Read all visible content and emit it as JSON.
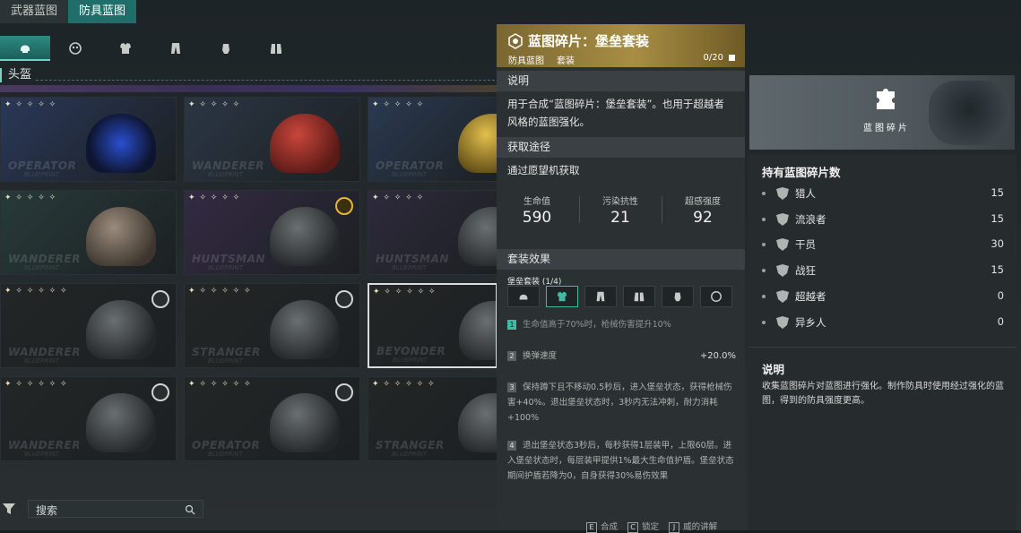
{
  "top_tabs": [
    {
      "label": "武器蓝图"
    },
    {
      "label": "防具蓝图"
    }
  ],
  "section_label": "头盔",
  "icons": [
    "helmet-icon",
    "mask-icon",
    "armor-icon",
    "pants-icon",
    "glove-icon",
    "boots-icon"
  ],
  "cards": [
    {
      "brand": "OPERATOR",
      "sub": "BLUEPRINT",
      "stars": "✦ ✧ ✧ ✧ ✧",
      "badge": "",
      "item": "goggles-item",
      "bg": "#2a3858"
    },
    {
      "brand": "WANDERER",
      "sub": "BLUEPRINT",
      "stars": "✦ ✧ ✧ ✧ ✧",
      "badge": "",
      "item": "red-helmet-item",
      "bg": "#2b3644"
    },
    {
      "brand": "OPERATOR",
      "sub": "BLUEPRINT",
      "stars": "✦ ✧ ✧ ✧ ✧",
      "badge": "",
      "item": "gold-helmet-item",
      "bg": "#2a3a52"
    },
    {
      "brand": "WANDERER",
      "sub": "BLUEPRINT",
      "stars": "✦ ✧ ✧ ✧ ✧",
      "badge": "",
      "item": "cap-item",
      "bg": "#283a3a"
    },
    {
      "brand": "HUNTSMAN",
      "sub": "BLUEPRINT",
      "stars": "✦ ✧ ✧ ✧ ✧",
      "badge": "gold",
      "item": "black-cap-item",
      "bg": "#342a44"
    },
    {
      "brand": "HUNTSMAN",
      "sub": "BLUEPRINT",
      "stars": "✦ ✧ ✧ ✧ ✧",
      "badge": "",
      "item": "hood-item",
      "bg": "#2e2a3c"
    },
    {
      "brand": "WANDERER",
      "sub": "BLUEPRINT",
      "stars": "✦ ✧ ✧ ✧ ✧ ✧",
      "badge": "grey",
      "item": "cowboy-hat-item",
      "bg": "#222626"
    },
    {
      "brand": "STRANGER",
      "sub": "BLUEPRINT",
      "stars": "✦ ✧ ✧ ✧ ✧ ✧",
      "badge": "grey",
      "item": "tactical-helmet-item",
      "bg": "#222626"
    },
    {
      "brand": "BEYONDER",
      "sub": "BLUEPRINT",
      "stars": "✦ ✧ ✧ ✧ ✧ ✧",
      "badge": "",
      "item": "headset-item",
      "bg": "#222626"
    },
    {
      "brand": "WANDERER",
      "sub": "BLUEPRINT",
      "stars": "✦ ✧ ✧ ✧ ✧ ✧",
      "badge": "grey",
      "item": "gas-mask-item",
      "bg": "#222626"
    },
    {
      "brand": "OPERATOR",
      "sub": "BLUEPRINT",
      "stars": "✦ ✧ ✧ ✧ ✧ ✧",
      "badge": "grey",
      "item": "skull-mask-item",
      "bg": "#222626"
    },
    {
      "brand": "STRANGER",
      "sub": "BLUEPRINT",
      "stars": "✦ ✧ ✧ ✧ ✧ ✧",
      "badge": "",
      "item": "respirator-item",
      "bg": "#222626"
    }
  ],
  "search": {
    "placeholder": "搜索"
  },
  "detail": {
    "title": "蓝图碎片：堡垒套装",
    "category": "防具蓝图",
    "type": "套装",
    "count": "0/20",
    "desc_header": "说明",
    "desc_line1": "用于合成“蓝图碎片：堡垒套装”。也用于超越者",
    "desc_line2": "风格的蓝图强化。",
    "source_header": "获取途径",
    "source": "通过愿望机获取",
    "stats": [
      {
        "label": "生命值",
        "value": "590"
      },
      {
        "label": "污染抗性",
        "value": "21"
      },
      {
        "label": "超感强度",
        "value": "92"
      }
    ],
    "set_header": "套装效果",
    "set_name": "堡垒套装 (1/4)",
    "effects": [
      {
        "num": "1",
        "text": "生命值高于70%时，枪械伤害提升10%",
        "val": ""
      },
      {
        "num": "2",
        "text": "换弹速度",
        "val": "+20.0%"
      },
      {
        "num": "3",
        "text": "保持蹲下且不移动0.5秒后，进入堡垒状态，获得枪械伤害+40%。退出堡垒状态时，3秒内无法冲刺，耐力消耗+100%",
        "val": ""
      },
      {
        "num": "4",
        "text": "退出堡垒状态3秒后，每秒获得1层装甲，上限60层。进入堡垒状态时，每层装甲提供1%最大生命值护盾。堡垒状态期间护盾若降为0，自身获得30%易伤效果",
        "val": ""
      }
    ],
    "keys": [
      {
        "key": "E",
        "label": "合成"
      },
      {
        "key": "C",
        "label": "锁定"
      },
      {
        "key": "J",
        "label": "威的讲解"
      }
    ]
  },
  "right": {
    "image_label": "蓝图碎片",
    "holdings_header": "持有蓝图碎片数",
    "fragments": [
      {
        "name": "猎人",
        "count": "15"
      },
      {
        "name": "流浪者",
        "count": "15"
      },
      {
        "name": "干员",
        "count": "30"
      },
      {
        "name": "战狂",
        "count": "15"
      },
      {
        "name": "超越者",
        "count": "0"
      },
      {
        "name": "异乡人",
        "count": "0"
      }
    ],
    "desc_header": "说明",
    "desc": "收集蓝图碎片对蓝图进行强化。制作防具时使用经过强化的蓝图，得到的防具强度更高。"
  },
  "colors": {
    "accent": "#2d8a82",
    "gold": "#a88e44",
    "effect_on": "#3fbba4"
  }
}
